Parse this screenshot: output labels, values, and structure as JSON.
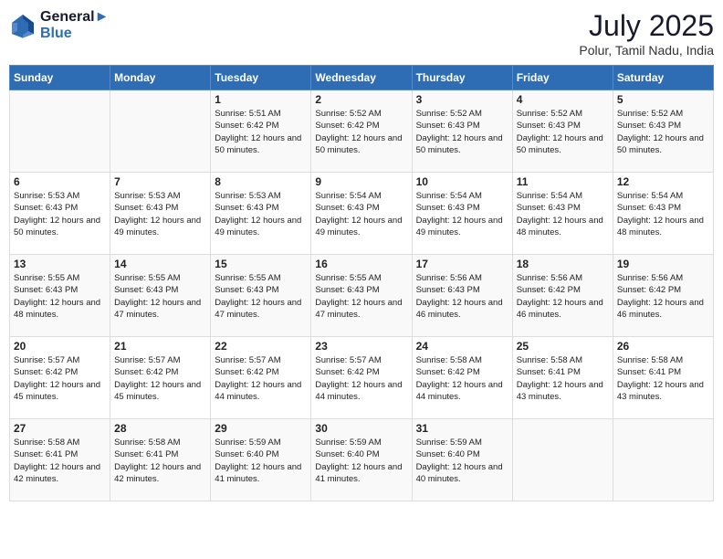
{
  "header": {
    "logo_line1": "General",
    "logo_line2": "Blue",
    "month_year": "July 2025",
    "location": "Polur, Tamil Nadu, India"
  },
  "weekdays": [
    "Sunday",
    "Monday",
    "Tuesday",
    "Wednesday",
    "Thursday",
    "Friday",
    "Saturday"
  ],
  "weeks": [
    [
      {
        "day": "",
        "info": ""
      },
      {
        "day": "",
        "info": ""
      },
      {
        "day": "1",
        "info": "Sunrise: 5:51 AM\nSunset: 6:42 PM\nDaylight: 12 hours and 50 minutes."
      },
      {
        "day": "2",
        "info": "Sunrise: 5:52 AM\nSunset: 6:42 PM\nDaylight: 12 hours and 50 minutes."
      },
      {
        "day": "3",
        "info": "Sunrise: 5:52 AM\nSunset: 6:43 PM\nDaylight: 12 hours and 50 minutes."
      },
      {
        "day": "4",
        "info": "Sunrise: 5:52 AM\nSunset: 6:43 PM\nDaylight: 12 hours and 50 minutes."
      },
      {
        "day": "5",
        "info": "Sunrise: 5:52 AM\nSunset: 6:43 PM\nDaylight: 12 hours and 50 minutes."
      }
    ],
    [
      {
        "day": "6",
        "info": "Sunrise: 5:53 AM\nSunset: 6:43 PM\nDaylight: 12 hours and 50 minutes."
      },
      {
        "day": "7",
        "info": "Sunrise: 5:53 AM\nSunset: 6:43 PM\nDaylight: 12 hours and 49 minutes."
      },
      {
        "day": "8",
        "info": "Sunrise: 5:53 AM\nSunset: 6:43 PM\nDaylight: 12 hours and 49 minutes."
      },
      {
        "day": "9",
        "info": "Sunrise: 5:54 AM\nSunset: 6:43 PM\nDaylight: 12 hours and 49 minutes."
      },
      {
        "day": "10",
        "info": "Sunrise: 5:54 AM\nSunset: 6:43 PM\nDaylight: 12 hours and 49 minutes."
      },
      {
        "day": "11",
        "info": "Sunrise: 5:54 AM\nSunset: 6:43 PM\nDaylight: 12 hours and 48 minutes."
      },
      {
        "day": "12",
        "info": "Sunrise: 5:54 AM\nSunset: 6:43 PM\nDaylight: 12 hours and 48 minutes."
      }
    ],
    [
      {
        "day": "13",
        "info": "Sunrise: 5:55 AM\nSunset: 6:43 PM\nDaylight: 12 hours and 48 minutes."
      },
      {
        "day": "14",
        "info": "Sunrise: 5:55 AM\nSunset: 6:43 PM\nDaylight: 12 hours and 47 minutes."
      },
      {
        "day": "15",
        "info": "Sunrise: 5:55 AM\nSunset: 6:43 PM\nDaylight: 12 hours and 47 minutes."
      },
      {
        "day": "16",
        "info": "Sunrise: 5:55 AM\nSunset: 6:43 PM\nDaylight: 12 hours and 47 minutes."
      },
      {
        "day": "17",
        "info": "Sunrise: 5:56 AM\nSunset: 6:43 PM\nDaylight: 12 hours and 46 minutes."
      },
      {
        "day": "18",
        "info": "Sunrise: 5:56 AM\nSunset: 6:42 PM\nDaylight: 12 hours and 46 minutes."
      },
      {
        "day": "19",
        "info": "Sunrise: 5:56 AM\nSunset: 6:42 PM\nDaylight: 12 hours and 46 minutes."
      }
    ],
    [
      {
        "day": "20",
        "info": "Sunrise: 5:57 AM\nSunset: 6:42 PM\nDaylight: 12 hours and 45 minutes."
      },
      {
        "day": "21",
        "info": "Sunrise: 5:57 AM\nSunset: 6:42 PM\nDaylight: 12 hours and 45 minutes."
      },
      {
        "day": "22",
        "info": "Sunrise: 5:57 AM\nSunset: 6:42 PM\nDaylight: 12 hours and 44 minutes."
      },
      {
        "day": "23",
        "info": "Sunrise: 5:57 AM\nSunset: 6:42 PM\nDaylight: 12 hours and 44 minutes."
      },
      {
        "day": "24",
        "info": "Sunrise: 5:58 AM\nSunset: 6:42 PM\nDaylight: 12 hours and 44 minutes."
      },
      {
        "day": "25",
        "info": "Sunrise: 5:58 AM\nSunset: 6:41 PM\nDaylight: 12 hours and 43 minutes."
      },
      {
        "day": "26",
        "info": "Sunrise: 5:58 AM\nSunset: 6:41 PM\nDaylight: 12 hours and 43 minutes."
      }
    ],
    [
      {
        "day": "27",
        "info": "Sunrise: 5:58 AM\nSunset: 6:41 PM\nDaylight: 12 hours and 42 minutes."
      },
      {
        "day": "28",
        "info": "Sunrise: 5:58 AM\nSunset: 6:41 PM\nDaylight: 12 hours and 42 minutes."
      },
      {
        "day": "29",
        "info": "Sunrise: 5:59 AM\nSunset: 6:40 PM\nDaylight: 12 hours and 41 minutes."
      },
      {
        "day": "30",
        "info": "Sunrise: 5:59 AM\nSunset: 6:40 PM\nDaylight: 12 hours and 41 minutes."
      },
      {
        "day": "31",
        "info": "Sunrise: 5:59 AM\nSunset: 6:40 PM\nDaylight: 12 hours and 40 minutes."
      },
      {
        "day": "",
        "info": ""
      },
      {
        "day": "",
        "info": ""
      }
    ]
  ]
}
